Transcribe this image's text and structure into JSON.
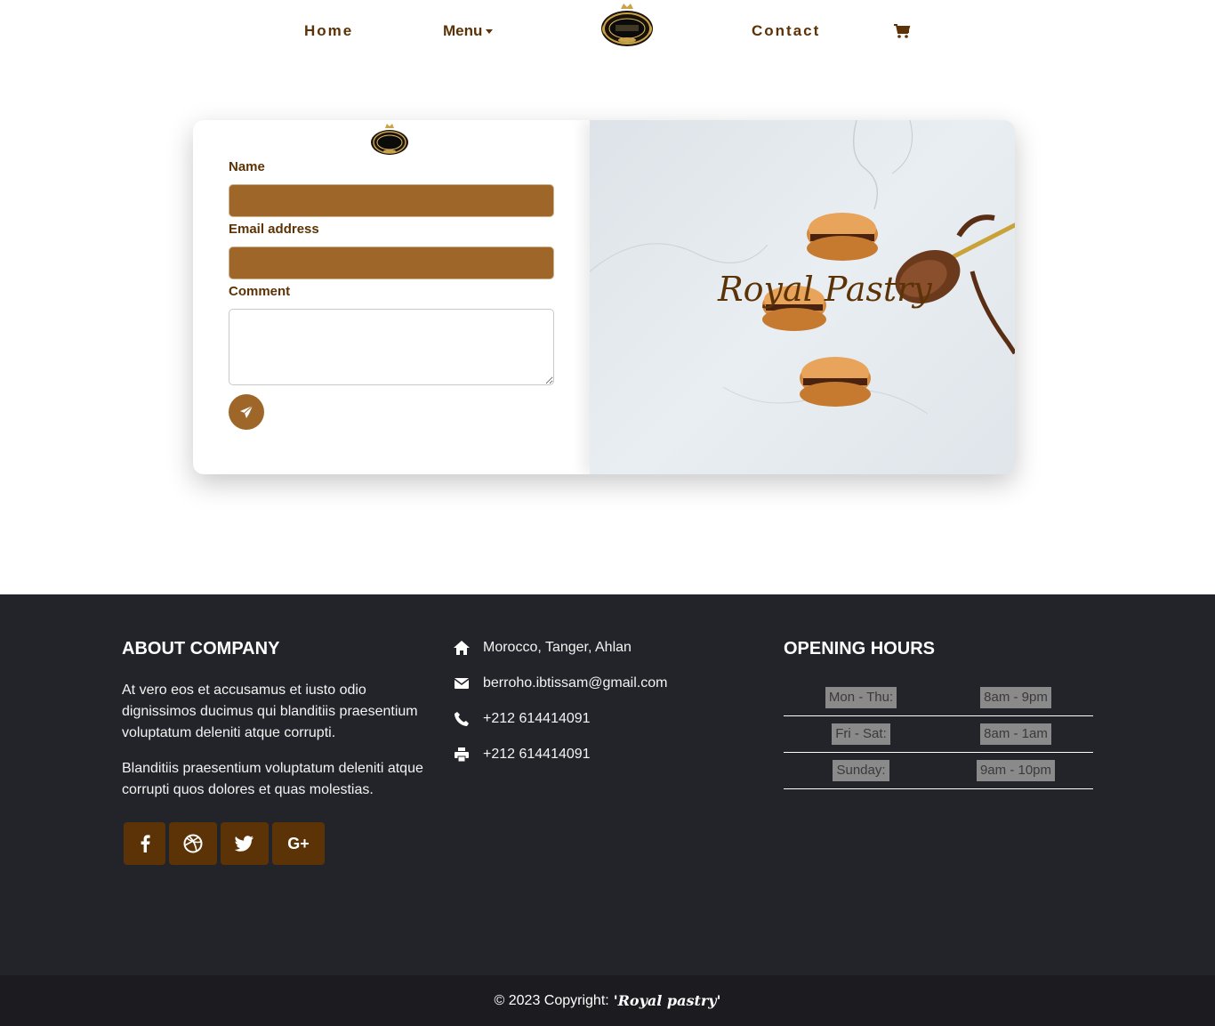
{
  "nav": {
    "home": "Home",
    "menu": "Menu",
    "contact": "Contact",
    "logo_icon": "royal-logo",
    "cart_icon": "shopping-cart-icon"
  },
  "form": {
    "name_label": "Name",
    "email_label": "Email address",
    "comment_label": "Comment",
    "name_value": "",
    "email_value": "",
    "comment_value": "",
    "send_icon": "paper-plane-icon"
  },
  "hero": {
    "title": "Royal Pastry"
  },
  "footer": {
    "about_title": "ABOUT COMPANY",
    "about_p1": "At vero eos et accusamus et iusto odio dignissimos ducimus qui blanditiis praesentium voluptatum deleniti atque corrupti.",
    "about_p2": "Blanditiis praesentium voluptatum deleniti atque corrupti quos dolores et quas molestias.",
    "contact": [
      {
        "icon": "home-icon",
        "text": "Morocco, Tanger, Ahlan"
      },
      {
        "icon": "envelope-icon",
        "text": "berroho.ibtissam@gmail.com"
      },
      {
        "icon": "phone-icon",
        "text": "+212 614414091"
      },
      {
        "icon": "printer-icon",
        "text": "+212 614414091"
      }
    ],
    "hours_title": "OPENING HOURS",
    "hours": [
      {
        "day": "Mon - Thu:",
        "time": "8am - 9pm"
      },
      {
        "day": "Fri - Sat:",
        "time": "8am - 1am"
      },
      {
        "day": "Sunday:",
        "time": "9am - 10pm"
      }
    ],
    "social": [
      "facebook-icon",
      "dribbble-icon",
      "twitter-icon",
      "google-plus-icon"
    ]
  },
  "copyright": {
    "text": "© 2023 Copyright:",
    "brand": "'Royal pastry'"
  },
  "colors": {
    "brand_brown": "#5b3306",
    "field_brown": "#9e6628",
    "footer_bg": "#23232a",
    "bottom_bg": "#1b1b20"
  }
}
